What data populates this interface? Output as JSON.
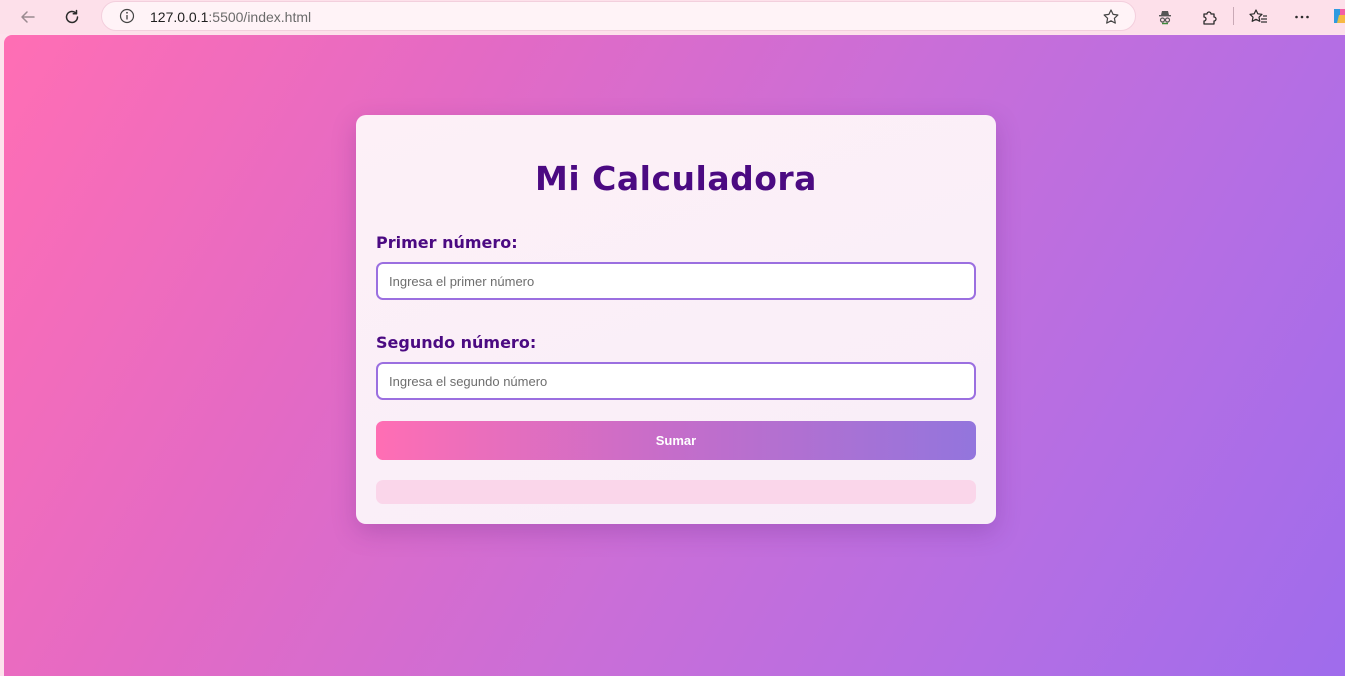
{
  "browser": {
    "url_host": "127.0.0.1",
    "url_rest": ":5500/index.html",
    "icons": {
      "back": "back-arrow-icon",
      "reload": "reload-icon",
      "info": "info-icon",
      "favorite": "star-icon",
      "profile": "incognito-icon",
      "extensions": "puzzle-icon",
      "favorites_bar": "favorites-icon",
      "menu": "more-icon",
      "copilot": "copilot-icon"
    }
  },
  "page": {
    "background_colors": [
      "#ff6eb4",
      "#9f6cec"
    ],
    "card": {
      "title": "Mi Calculadora",
      "first_label": "Primer número:",
      "first_placeholder": "Ingresa el primer número",
      "first_value": "",
      "second_label": "Segundo número:",
      "second_placeholder": "Ingresa el segundo número",
      "second_value": "",
      "button_label": "Sumar",
      "result": ""
    },
    "accent_color": "#4b0a82",
    "input_border_color": "#9b6fe0"
  }
}
